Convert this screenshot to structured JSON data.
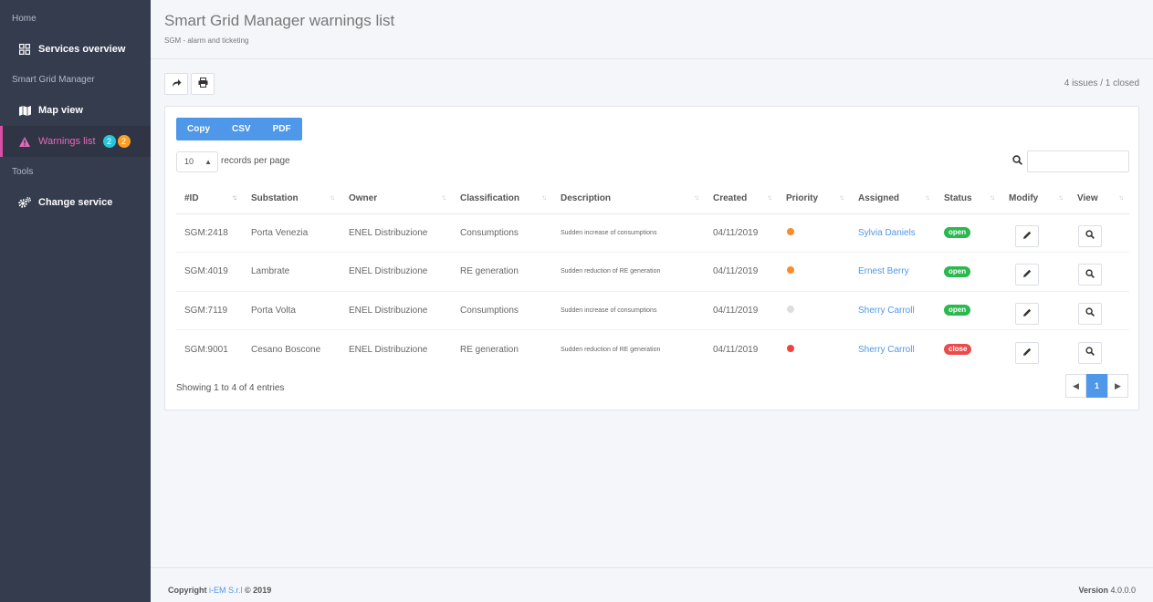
{
  "sidebar": {
    "sections": [
      {
        "label": "Home"
      },
      {
        "label": "Smart Grid Manager"
      },
      {
        "label": "Tools"
      }
    ],
    "items": [
      {
        "label": "Services overview",
        "icon": "grid-icon"
      },
      {
        "label": "Map view",
        "icon": "map-icon"
      },
      {
        "label": "Warnings list",
        "icon": "warning-icon",
        "badges": [
          "2",
          "2"
        ]
      },
      {
        "label": "Change service",
        "icon": "cogs-icon"
      }
    ]
  },
  "header": {
    "title": "Smart Grid Manager warnings list",
    "subtitle": "SGM - alarm and ticketing"
  },
  "toolbar": {
    "summary": "4 issues / 1 closed"
  },
  "export": {
    "buttons": [
      "Copy",
      "CSV",
      "PDF"
    ]
  },
  "length": {
    "value": "10",
    "label": "records per page"
  },
  "table": {
    "columns": [
      "#ID",
      "Substation",
      "Owner",
      "Classification",
      "Description",
      "Created",
      "Priority",
      "Assigned",
      "Status",
      "Modify",
      "View"
    ],
    "rows": [
      {
        "id": "SGM:2418",
        "substation": "Porta Venezia",
        "owner": "ENEL Distribuzione",
        "classification": "Consumptions",
        "description": "Sudden increase of consumptions",
        "created": "04/11/2019",
        "priority": "orange",
        "assigned": "Sylvia Daniels",
        "status": "open"
      },
      {
        "id": "SGM:4019",
        "substation": "Lambrate",
        "owner": "ENEL Distribuzione",
        "classification": "RE generation",
        "description": "Sudden reduction of RE generation",
        "created": "04/11/2019",
        "priority": "orange",
        "assigned": "Ernest Berry",
        "status": "open"
      },
      {
        "id": "SGM:7119",
        "substation": "Porta Volta",
        "owner": "ENEL Distribuzione",
        "classification": "Consumptions",
        "description": "Sudden increase of consumptions",
        "created": "04/11/2019",
        "priority": "grey",
        "assigned": "Sherry Carroll",
        "status": "open"
      },
      {
        "id": "SGM:9001",
        "substation": "Cesano Boscone",
        "owner": "ENEL Distribuzione",
        "classification": "RE generation",
        "description": "Sudden reduction of RE generation",
        "created": "04/11/2019",
        "priority": "red",
        "assigned": "Sherry Carroll",
        "status": "close"
      }
    ],
    "info": "Showing 1 to 4 of 4 entries"
  },
  "pagination": {
    "current": "1"
  },
  "colors": {
    "priority_orange": "#fb8c2a",
    "priority_grey": "#dedede",
    "priority_red": "#f0433e",
    "status_open": "#2bb84f",
    "status_close": "#ec4b4b",
    "accent": "#4f97e8",
    "active_nav": "#e56ab8"
  },
  "footer": {
    "copyright_prefix": "Copyright",
    "company": "i-EM S.r.l",
    "copyright_suffix": "© 2019",
    "version_label": "Version",
    "version": "4.0.0.0"
  }
}
